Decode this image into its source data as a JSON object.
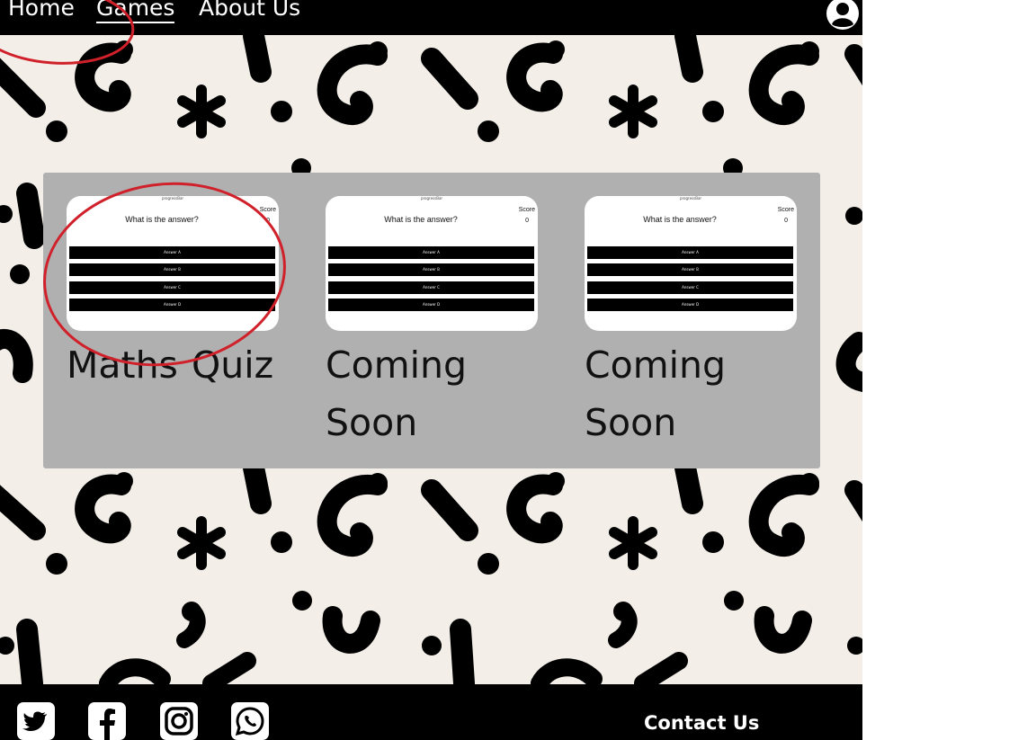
{
  "nav": {
    "links": [
      {
        "label": "Home"
      },
      {
        "label": "Games"
      },
      {
        "label": "About Us"
      }
    ],
    "active": "Games",
    "user_icon": "user-circle-icon"
  },
  "games": [
    {
      "title": "Maths Quiz",
      "thumbnail": {
        "brand": "progressBar",
        "question": "What is the answer?",
        "score_label": "Score",
        "score_value": "0",
        "answers": [
          "Answer A",
          "Answer B",
          "Answer C",
          "Answer D"
        ]
      }
    },
    {
      "title": "Coming Soon",
      "thumbnail": {
        "brand": "progressBar",
        "question": "What is the answer?",
        "score_label": "Score",
        "score_value": "0",
        "answers": [
          "Answer A",
          "Answer B",
          "Answer C",
          "Answer D"
        ]
      }
    },
    {
      "title": "Coming Soon",
      "thumbnail": {
        "brand": "progressBar",
        "question": "What is the answer?",
        "score_label": "Score",
        "score_value": "0",
        "answers": [
          "Answer A",
          "Answer B",
          "Answer C",
          "Answer D"
        ]
      }
    }
  ],
  "footer": {
    "social": [
      "twitter-icon",
      "facebook-icon",
      "instagram-icon",
      "whatsapp-icon"
    ],
    "contact_label": "Contact Us"
  },
  "colors": {
    "background": "#f3efe8",
    "nav": "#000000",
    "panel": "#b0b0b0",
    "annotation": "#d0202a"
  }
}
